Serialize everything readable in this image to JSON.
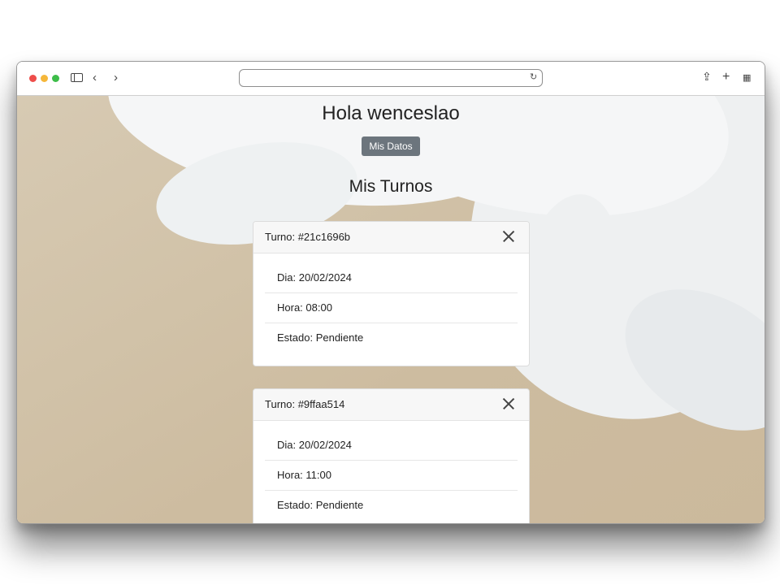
{
  "browser": {
    "url_value": "",
    "icons": [
      "sidebar-icon",
      "back-icon",
      "forward-icon",
      "reload-icon",
      "share-icon",
      "new-tab-icon",
      "tab-overview-icon"
    ]
  },
  "page": {
    "greeting": "Hola wenceslao",
    "mis_datos_button": "Mis Datos",
    "section_title": "Mis Turnos",
    "button_color": "#6c757d"
  },
  "turnos": [
    {
      "title": "Turno: #21c1696b",
      "dia": "Dia: 20/02/2024",
      "hora": "Hora: 08:00",
      "estado": "Estado: Pendiente"
    },
    {
      "title": "Turno: #9ffaa514",
      "dia": "Dia: 20/02/2024",
      "hora": "Hora: 11:00",
      "estado": "Estado: Pendiente"
    }
  ]
}
